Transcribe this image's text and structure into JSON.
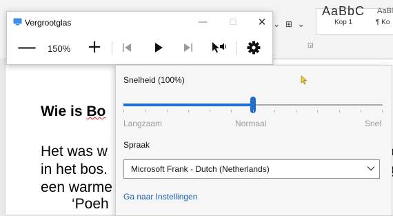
{
  "word": {
    "style_previews": {
      "heading_sample": "AaBbC",
      "small_sample": "AaBl"
    },
    "styles": [
      "Kop 1",
      "¶ Ko"
    ],
    "document": {
      "heading_prefix": "Wie is ",
      "heading_spelled": "Bo",
      "lines": [
        "Het was w",
        "in het bos.",
        "een warme",
        "‘Poeh"
      ],
      "right_edge_chars": [
        "c",
        "g"
      ]
    }
  },
  "magnifier": {
    "title": "Vergrootglas",
    "zoom_level": "150%",
    "window_buttons": {
      "minimize": "—",
      "maximize": "☐",
      "close": "✕"
    },
    "toolbar": {
      "zoom_out_label": "—",
      "zoom_in_label": "+"
    },
    "icons": {
      "app": "magnifier-app-icon",
      "previous": "previous-paragraph-icon",
      "play": "play-icon",
      "next": "next-paragraph-icon",
      "read_from_here": "read-from-here-icon",
      "settings": "gear-icon"
    }
  },
  "flyout": {
    "speed_label": "Snelheid (100%)",
    "speed_fraction": 0.5,
    "slider_labels": {
      "slow": "Langzaam",
      "normal": "Normaal",
      "fast": "Snel"
    },
    "voice_label": "Spraak",
    "voice_value": "Microsoft Frank - Dutch (Netherlands)",
    "settings_link": "Ga naar Instellingen"
  },
  "colors": {
    "accent": "#1e6fcf",
    "link": "#1a62b5",
    "cursor": "#f2d22e"
  }
}
